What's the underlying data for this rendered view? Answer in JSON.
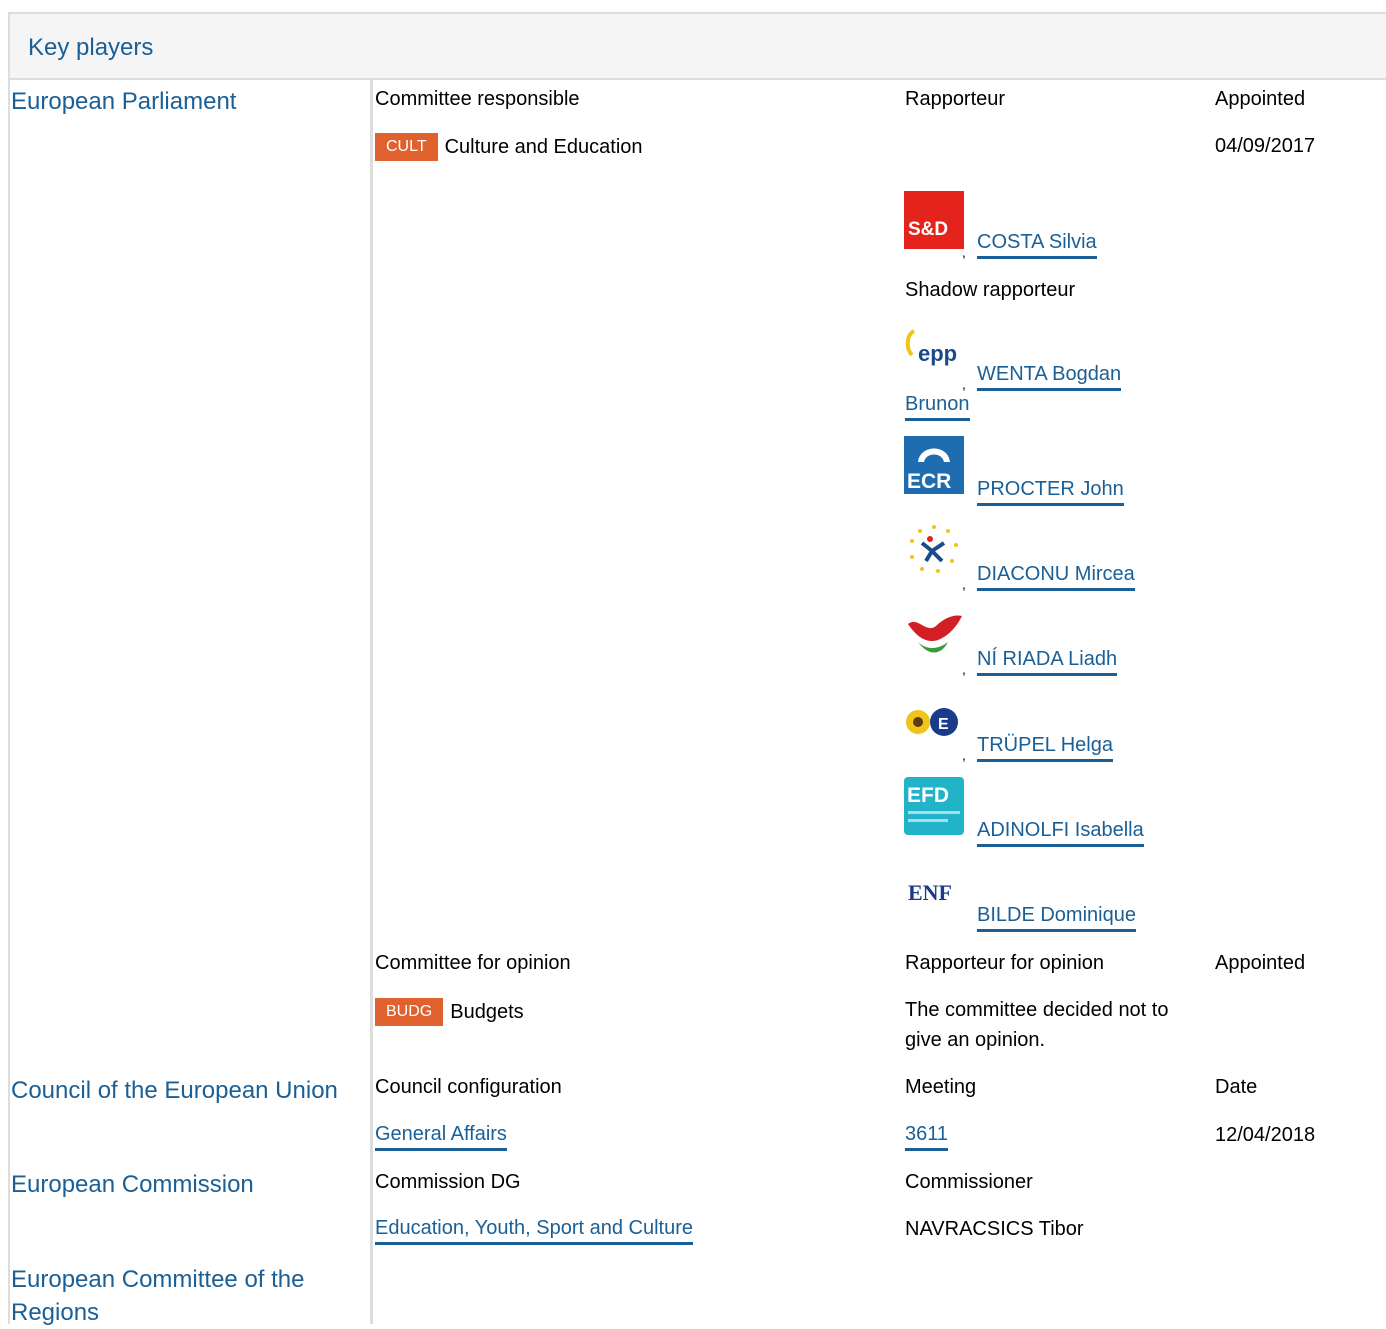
{
  "panel": {
    "title": "Key players"
  },
  "ep": {
    "org": "European Parliament",
    "committee_responsible_label": "Committee responsible",
    "rapporteur_label": "Rapporteur",
    "appointed_label": "Appointed",
    "committee": {
      "code": "CULT",
      "name": "Culture and Education",
      "appointed": "04/09/2017"
    },
    "rapporteur": {
      "party_logo_text": "S&D",
      "name": "COSTA Silvia",
      "color": "#e3231c"
    },
    "shadow_label": "Shadow rapporteur",
    "shadows": [
      {
        "name_line1": "WENTA Bogdan",
        "name_line2": "Brunon",
        "logo": "epp",
        "logo_text": "epp"
      },
      {
        "name_line1": "PROCTER John",
        "logo": "ecr",
        "logo_text": "ECR"
      },
      {
        "name_line1": "DIACONU Mircea",
        "logo": "alde"
      },
      {
        "name_line1": "NÍ RIADA Liadh",
        "logo": "gue"
      },
      {
        "name_line1": "TRÜPEL Helga",
        "logo": "greens"
      },
      {
        "name_line1": "ADINOLFI Isabella",
        "logo": "efd",
        "logo_text": "EFD"
      },
      {
        "name_line1": "BILDE Dominique",
        "logo": "enf",
        "logo_text": "ENF"
      }
    ],
    "opinion_label": "Committee for opinion",
    "rapporteur_opinion_label": "Rapporteur for opinion",
    "opinion_appointed_label": "Appointed",
    "opinion_committee": {
      "code": "BUDG",
      "name": "Budgets"
    },
    "opinion_note_line1": "The committee decided not to",
    "opinion_note_line2": "give an opinion.",
    "badge_color": "#e0612e"
  },
  "council": {
    "org": "Council of the European Union",
    "config_label": "Council configuration",
    "meeting_label": "Meeting",
    "date_label": "Date",
    "config": "General Affairs",
    "meeting": "3611",
    "date": "12/04/2018"
  },
  "commission": {
    "org": "European Commission",
    "dg_label": "Commission DG",
    "commissioner_label": "Commissioner",
    "dg": "Education, Youth, Sport and Culture",
    "commissioner": "NAVRACSICS Tibor"
  },
  "regions": {
    "org_line1": "European Committee of the",
    "org_line2": "Regions"
  },
  "link_color": "#1a5f96"
}
